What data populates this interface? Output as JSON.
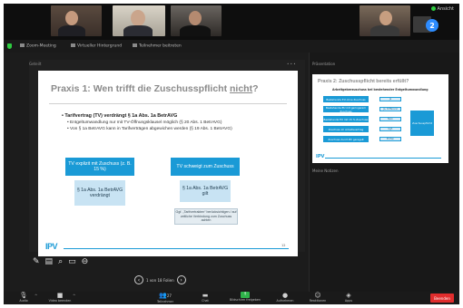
{
  "top": {
    "speaker_badge": "2",
    "view_toggle": "Ansicht"
  },
  "tabs": [
    {
      "label": "Zoom-Meeting"
    },
    {
      "label": "Virtueller Hintergrund"
    },
    {
      "label": "Teilnehmer beitreten"
    }
  ],
  "share": {
    "header": "Geteilt",
    "dots": "• • •"
  },
  "slide": {
    "title_part1": "Praxis 1: Wen trifft die Zuschusspflicht ",
    "title_part2": "nicht",
    "title_part3": "?",
    "bullet_main": "Tarifvertrag (TV) verdrängt § 1a Abs. 1a BetrAVG",
    "sub1": "Entgeltumwandlung nur mit TV-Öffnungsklausel möglich (§ 20 Abs. 1 BetrAVG)",
    "sub2": "Von § 1a BetrAVG kann in Tarifverträgen abgewichen werden (§ 19 Abs. 1 BetrAVG)",
    "box1": "TV explizit mit Zuschuss (z. B. 15 %)",
    "box2": "TV schweigt zum Zuschuss",
    "box3": "§ 1a Abs. 1a BetrAVG verdrängt",
    "box4": "§ 1a Abs. 1a BetrAVG gilt",
    "box5": "Ggf. „Tarifvertrakten“ berücksichtigen / auf zeitliche Verbindung zum Zuschuss achten",
    "logo": "IPV",
    "corner": "12"
  },
  "pager": {
    "label": "1 von 18 Folien"
  },
  "right": {
    "label_top": "Präsentation",
    "label_mid": "Meine Notizen",
    "preview_title": "Praxis 2: Zuschusspflicht bereits erfüllt?",
    "preview_sub": "Arbeitgeberzuschuss bei bestehender Entgeltumwandlung",
    "pv_box1": "Bestehende EU ohne Zuschuss",
    "pv_box2": "Bestehende EU mit geringerem Zuschuss",
    "pv_box3": "Bestehende EU mit 15 % Zuschuss",
    "pv_box4": "Zuschuss im Arbeitsvertrag",
    "pv_box5": "Zuschuss durch BV geregelt",
    "pv_s1": "Ja",
    "pv_s2": "Ja, Differenz",
    "pv_s3": "Nein",
    "pv_s4": "Ggf.",
    "pv_s5": "Prüfen",
    "pv_side": "Zuschusspflicht",
    "pv_logo": "IPV"
  },
  "toolbar": {
    "audio": "Audio",
    "video": "Video beenden",
    "participants": "Teilnehmer",
    "participants_count": "27",
    "chat": "Chat",
    "share": "Bildschirm freigeben",
    "record": "Aufnehmen",
    "reactions": "Reaktionen",
    "apps": "Apps",
    "end": "Beenden"
  }
}
